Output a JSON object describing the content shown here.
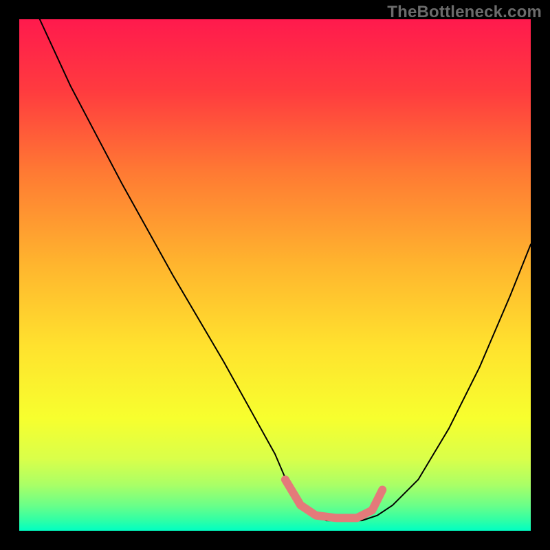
{
  "watermark": "TheBottleneck.com",
  "chart_data": {
    "type": "line",
    "title": "",
    "xlabel": "",
    "ylabel": "",
    "xlim": [
      0,
      100
    ],
    "ylim": [
      0,
      100
    ],
    "series": [
      {
        "name": "curve",
        "x": [
          4,
          10,
          20,
          30,
          40,
          50,
          53,
          56,
          60,
          64,
          67,
          70,
          73,
          78,
          84,
          90,
          96,
          100
        ],
        "values": [
          100,
          87,
          68,
          50,
          33,
          15,
          8,
          4,
          2,
          2,
          2,
          3,
          5,
          10,
          20,
          32,
          46,
          56
        ],
        "color": "#000000",
        "width": 2
      },
      {
        "name": "highlight",
        "x": [
          52,
          55,
          58,
          62,
          66,
          69,
          71
        ],
        "values": [
          10,
          5,
          3,
          2.5,
          2.5,
          4,
          8
        ],
        "color": "#e47a7a",
        "width": 12
      }
    ],
    "background": "gradient",
    "gradient_stops": [
      {
        "offset": 0,
        "color": "#ff1a4d"
      },
      {
        "offset": 14,
        "color": "#ff3b3f"
      },
      {
        "offset": 30,
        "color": "#ff7a33"
      },
      {
        "offset": 48,
        "color": "#ffb52e"
      },
      {
        "offset": 64,
        "color": "#ffe22e"
      },
      {
        "offset": 78,
        "color": "#f7ff2e"
      },
      {
        "offset": 86,
        "color": "#d9ff4a"
      },
      {
        "offset": 91,
        "color": "#aaff66"
      },
      {
        "offset": 95,
        "color": "#6bff88"
      },
      {
        "offset": 98,
        "color": "#2effa6"
      },
      {
        "offset": 100,
        "color": "#00ffc3"
      }
    ]
  }
}
